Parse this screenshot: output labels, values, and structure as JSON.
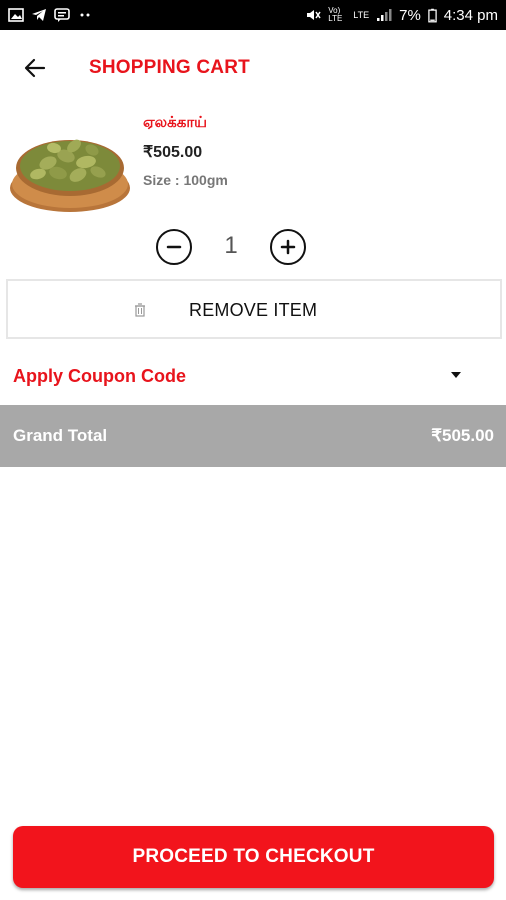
{
  "status_bar": {
    "icons_left": [
      "image-icon",
      "telegram-icon",
      "chat-icon",
      "more-dots-icon"
    ],
    "network_labels": [
      "Vo) LTE",
      "LTE"
    ],
    "battery": "7%",
    "time": "4:34 pm"
  },
  "header": {
    "title": "SHOPPING CART",
    "back_icon": "arrow-back-icon"
  },
  "cart_item": {
    "name": "ஏலக்காய்",
    "price": "₹505.00",
    "size": "Size : 100gm",
    "quantity": "1",
    "image": "cardamom-in-wooden-bowl"
  },
  "remove_item": {
    "label": "REMOVE ITEM",
    "icon": "trash-icon"
  },
  "coupon": {
    "label": "Apply Coupon Code",
    "icon": "caret-down-icon"
  },
  "total": {
    "label": "Grand Total",
    "value": "₹505.00"
  },
  "checkout": {
    "label": "PROCEED TO CHECKOUT"
  },
  "colors": {
    "accent": "#e8141c",
    "checkout_bg": "#f2141c",
    "total_bar": "#a8a8a8",
    "status_bar": "#000000"
  }
}
